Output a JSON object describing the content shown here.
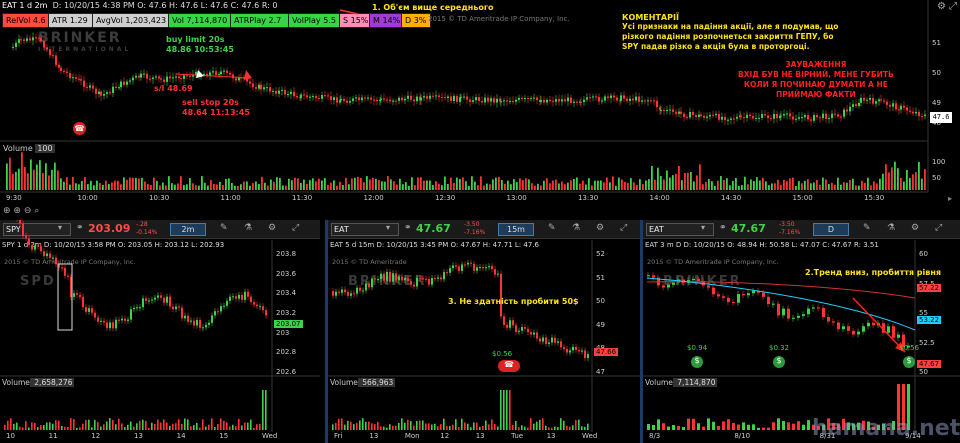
{
  "main_chart": {
    "header": "EAT 1 d 2m",
    "ohlc": "D: 10/20/15 4:38 PM  O: 47.6  H: 47.6  L: 47.6  C: 47.6  R: 0",
    "tags": [
      {
        "label": "RelVol 4.6",
        "bg": "#ff4a3d"
      },
      {
        "label": "ATR 1.29",
        "bg": "#cfcfcf"
      },
      {
        "label": "AvgVol 1,203,423",
        "bg": "#cfcfcf"
      },
      {
        "label": "Vol 7,114,870",
        "bg": "#35d646"
      },
      {
        "label": "ATRPlay 2.7",
        "bg": "#35d646"
      },
      {
        "label": "VolPlay 5.5",
        "bg": "#35d646"
      },
      {
        "label": "S 15%",
        "bg": "#ff8fb6"
      },
      {
        "label": "M 14%",
        "bg": "#a13bd6"
      },
      {
        "label": "D 3%",
        "bg": "#ffb000"
      }
    ],
    "copyright": "2015 © TD Ameritrade IP Company, Inc.",
    "watermark": "BRINKER",
    "watermark_sub": "INTERNATIONAL",
    "price_ticks": [
      "51",
      "50",
      "49",
      "48"
    ],
    "last_price": "47.6",
    "time_ticks": [
      "9:30",
      "10:00",
      "10:30",
      "11:00",
      "11:30",
      "12:00",
      "12:30",
      "13:00",
      "13:30",
      "14:00",
      "14:30",
      "15:00",
      "15:30"
    ],
    "volume_label": "Volume",
    "volume_value": "100",
    "volume_ticks": [
      "100",
      "50"
    ],
    "annotations": {
      "volume_note": "1. Об'єм вище середнього",
      "buy_limit": "buy limit 20s",
      "buy_limit_detail": "48.86 10:53:45",
      "stop_loss": "s/l 48.69",
      "sell_stop": "sell stop 20s",
      "sell_stop_detail": "48.64 11:13:45"
    },
    "commentary_title": "КОМЕНТАРІЇ",
    "commentary_lines": [
      "Усі признаки на падіння акції, але я подумав, що",
      "різкого падіння розпочнеться закриття ГЕПУ, бо",
      "SPY  падав різко а акція була в проторгоці."
    ],
    "warning_title": "ЗАУВАЖЕННЯ",
    "warning_lines": [
      "ВХІД БУВ НЕ ВІРНИЙ, МЕНЕ ГУБИТЬ",
      "КОЛИ Я ПОЧИНАЮ ДУМАТИ А НЕ",
      "ПРИЙМАЮ ФАКТИ"
    ]
  },
  "panels": [
    {
      "symbol": "SPY",
      "price": "203.09",
      "change": "-.28",
      "change_pct": "-0.14%",
      "price_color": "#ff4d4d",
      "timeframe": "2m",
      "header": "SPY 1 d 2m",
      "ohlc": "D: 10/20/15 3:58 PM  O: 203.05  H: 203.12  L: 202.93",
      "copyright": "2015 © TD Ameritrade IP Company, Inc.",
      "price_ticks": [
        "203.8",
        "203.6",
        "203.4",
        "203.2",
        "203",
        "202.8",
        "202.6"
      ],
      "last_price": "203.07",
      "volume_label": "Volume",
      "volume_value": "2,658,276",
      "x_ticks": [
        "10",
        "11",
        "12",
        "13",
        "14",
        "15",
        "Wed"
      ],
      "watermark": "SPD",
      "annotation": ""
    },
    {
      "symbol": "EAT",
      "price": "47.67",
      "change": "-3.50",
      "change_pct": "-7.16%",
      "price_color": "#3dd24a",
      "timeframe": "15m",
      "header": "EAT 5 d 15m",
      "ohlc": "D: 10/20/15 3:45 PM  O: 47.67  H: 47.71  L: 47.6",
      "copyright": "2015 © TD Ameritrade",
      "price_ticks": [
        "52",
        "51",
        "50",
        "49",
        "48",
        "47"
      ],
      "last_price": "47.66",
      "volume_label": "Volume",
      "volume_value": "566,963",
      "x_ticks": [
        "Fri",
        "13",
        "Mon",
        "12",
        "13",
        "Tue",
        "13",
        "Wed"
      ],
      "watermark": "BRINKER",
      "annotation": "3. Не здатність пробити 50$",
      "dividend": "$0.56"
    },
    {
      "symbol": "EAT",
      "price": "47.67",
      "change": "-3.50",
      "change_pct": "-7.16%",
      "price_color": "#3dd24a",
      "timeframe": "D",
      "header": "EAT 3 m D",
      "ohlc": "D: 10/20/15  O: 48.94  H: 50.58  L: 47.07  C: 47.67  R: 3.51",
      "copyright": "2015 © TD Ameritrade IP Company, Inc.",
      "price_ticks": [
        "60",
        "57.5",
        "55",
        "52.5",
        "50"
      ],
      "last_price": "47.67",
      "ma_labels": [
        "57.22",
        "53.22"
      ],
      "volume_label": "Volume",
      "volume_value": "7,114,870",
      "x_ticks": [
        "8/3",
        "8/10",
        "8/31",
        "9/14"
      ],
      "watermark": "BRINKER",
      "annotation": "2.Тренд вниз, пробиття рівня",
      "dividends": [
        "$0.94",
        "$0.32",
        "$0.56"
      ]
    }
  ],
  "site_watermark": "hamana.net"
}
